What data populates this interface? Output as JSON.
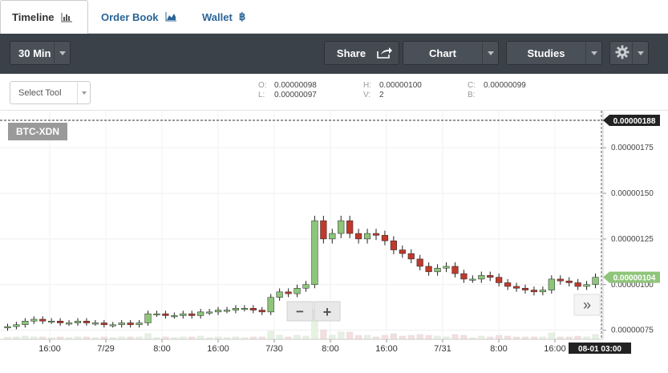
{
  "tabs": [
    {
      "label": "Timeline",
      "icon": "bar-chart-icon"
    },
    {
      "label": "Order Book",
      "icon": "area-chart-icon"
    },
    {
      "label": "Wallet",
      "icon": "bitcoin-icon"
    }
  ],
  "toolbar": {
    "period": "30 Min",
    "share": "Share",
    "chart": "Chart",
    "studies": "Studies",
    "settings_icon": "gear-icon"
  },
  "subbar": {
    "select_tool_placeholder": "Select Tool",
    "ohlc": {
      "o_label": "O:",
      "o_value": "0.00000098",
      "l_label": "L:",
      "l_value": "0.00000097",
      "h_label": "H:",
      "h_value": "0.00000100",
      "v_label": "V:",
      "v_value": "2",
      "c_label": "C:",
      "c_value": "0.00000099",
      "b_label": "B:",
      "b_value": ""
    }
  },
  "chart": {
    "symbol": "BTC-XDN",
    "zoom_out": "−",
    "zoom_in": "+",
    "scroll_right": "»",
    "high_marker": "0.00000188",
    "last_marker": "0.00000104",
    "cursor_time": "08-01 03:00"
  },
  "colors": {
    "up": "#8ec57a",
    "down": "#c0392b",
    "toolbar": "#3b4149",
    "last": "#8ec57a"
  },
  "chart_data": {
    "type": "candlestick",
    "pair": "BTC-XDN",
    "y_ticks": [
      "0.00000175",
      "0.00000150",
      "0.00000125",
      "0.00000100",
      "0.00000075"
    ],
    "ylim": [
      7e-07,
      1.9e-06
    ],
    "x_ticks": [
      "16:00",
      "7/29",
      "8:00",
      "16:00",
      "7/30",
      "8:00",
      "16:00",
      "7/31",
      "8:00",
      "16:00"
    ],
    "high_value": 1.88e-06,
    "last_value": 1.04e-06,
    "series": [
      {
        "name": "close",
        "values": [
          7.7e-07,
          7.8e-07,
          8e-07,
          8.1e-07,
          8e-07,
          8e-07,
          7.9e-07,
          7.9e-07,
          8e-07,
          7.9e-07,
          7.9e-07,
          7.8e-07,
          7.8e-07,
          7.9e-07,
          7.8e-07,
          7.9e-07,
          8.4e-07,
          8.4e-07,
          8.3e-07,
          8.3e-07,
          8.4e-07,
          8.3e-07,
          8.5e-07,
          8.5e-07,
          8.6e-07,
          8.6e-07,
          8.7e-07,
          8.7e-07,
          8.6e-07,
          8.5e-07,
          9.3e-07,
          9.6e-07,
          9.5e-07,
          9.8e-07,
          1e-06,
          1.35e-06,
          1.25e-06,
          1.28e-06,
          1.35e-06,
          1.28e-06,
          1.25e-06,
          1.28e-06,
          1.27e-06,
          1.24e-06,
          1.19e-06,
          1.17e-06,
          1.14e-06,
          1.1e-06,
          1.07e-06,
          1.09e-06,
          1.1e-06,
          1.06e-06,
          1.03e-06,
          1.03e-06,
          1.05e-06,
          1.04e-06,
          1.01e-06,
          9.9e-07,
          9.8e-07,
          9.7e-07,
          9.6e-07,
          9.7e-07,
          1.03e-06,
          1.02e-06,
          1.01e-06,
          9.9e-07,
          1e-06,
          1.04e-06
        ]
      }
    ]
  }
}
